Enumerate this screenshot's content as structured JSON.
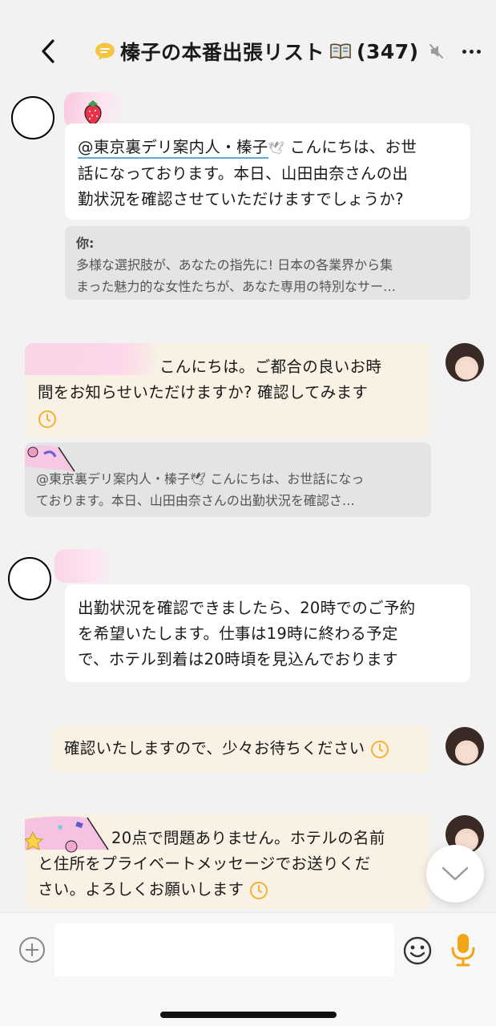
{
  "header": {
    "title": "榛子の本番出張リスト",
    "count": "(347)"
  },
  "messages": [
    {
      "id": "m1",
      "mention": "@東京裏デリ案内人・榛子",
      "line1": "こんにちは、お世",
      "line2": "話になっております。本日、山田由奈さんの出",
      "line3": "勤状況を確認させていただけますでしょうか?",
      "quote_name": "你:",
      "quote_line1": "多様な選択肢が、あなたの指先に! 日本の各業界から集",
      "quote_line2": "まった魅力的な女性たちが、あなた専用の特別なサー…"
    },
    {
      "id": "m2",
      "line1": "こんにちは。ご都合の良いお時",
      "line2": "間をお知らせいただけますか? 確認してみます",
      "quote_line1": "@東京裏デリ案内人・榛子🕊 こんにちは、お世話になっ",
      "quote_line2": "ております。本日、山田由奈さんの出勤状況を確認さ…"
    },
    {
      "id": "m3",
      "line1": "出勤状況を確認できましたら、20時でのご予約",
      "line2": "を希望いたします。仕事は19時に終わる予定",
      "line3": "で、ホテル到着は20時頃を見込んでおります"
    },
    {
      "id": "m4",
      "line1": "確認いたしますので、少々お待ちください"
    },
    {
      "id": "m5",
      "line1": "20点で問題ありません。ホテルの名前",
      "line2": "と住所をプライベートメッセージでお送りくだ",
      "line3": "さい。よろしくお願いします"
    }
  ],
  "input": {
    "placeholder": ""
  },
  "icons": {
    "back": "chevron-left-icon",
    "chat_bubble": "speech-bubble-icon",
    "book": "book-icon",
    "mute": "mute-icon",
    "more": "more-dots-icon",
    "add": "plus-circle-icon",
    "emoji": "emoji-icon",
    "mic": "microphone-icon",
    "scroll_down": "chevron-down-icon",
    "clock": "clock-icon"
  },
  "colors": {
    "accent_mic": "#f2a516",
    "mention_underline": "#5fa8d3",
    "bubble_cream": "#f8f1e4",
    "clock": "#f2b233"
  }
}
